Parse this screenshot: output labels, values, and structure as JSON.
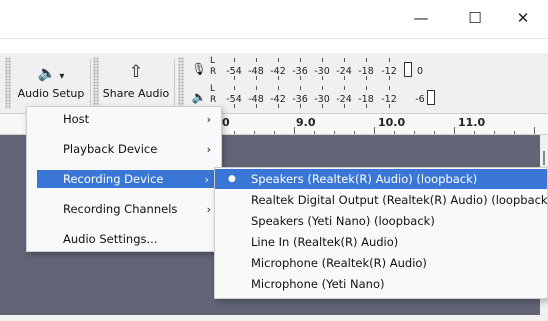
{
  "window": {
    "minimize_icon": "minimize-icon",
    "maximize_icon": "maximize-icon",
    "close_icon": "close-icon",
    "minimize_glyph": "—",
    "maximize_glyph": "☐",
    "close_glyph": "✕"
  },
  "toolbar": {
    "audio_setup": {
      "label": "Audio Setup",
      "icon": "speaker-icon",
      "glyph": "🔈",
      "dropdown_glyph": "▾"
    },
    "share_audio": {
      "label": "Share Audio",
      "icon": "share-icon",
      "glyph": "⇧"
    }
  },
  "meters": {
    "record": {
      "icon": "microphone-icon",
      "glyph": "🎙",
      "l": "L",
      "r": "R",
      "ticks": [
        "-54",
        "-48",
        "-42",
        "-36",
        "-30",
        "-24",
        "-18",
        "-12",
        "0"
      ]
    },
    "playback": {
      "icon": "speaker-icon",
      "glyph": "🔈",
      "l": "L",
      "r": "R",
      "ticks": [
        "-54",
        "-48",
        "-42",
        "-36",
        "-30",
        "-24",
        "-18",
        "-12",
        "-6"
      ]
    }
  },
  "ruler": {
    "labels": [
      "0",
      "9.0",
      "10.0",
      "11.0"
    ]
  },
  "audio_setup_menu": {
    "items": [
      {
        "label": "Host",
        "submenu": true
      },
      {
        "label": "Playback Device",
        "submenu": true
      },
      {
        "label": "Recording Device",
        "submenu": true,
        "selected": true
      },
      {
        "label": "Recording Channels",
        "submenu": true
      },
      {
        "label": "Audio Settings...",
        "submenu": false
      }
    ],
    "arrow_glyph": "›"
  },
  "recording_device_submenu": {
    "items": [
      {
        "label": "Speakers (Realtek(R) Audio) (loopback)",
        "checked": true
      },
      {
        "label": "Realtek Digital Output (Realtek(R) Audio) (loopback)",
        "checked": false
      },
      {
        "label": "Speakers (Yeti Nano) (loopback)",
        "checked": false
      },
      {
        "label": "Line In (Realtek(R) Audio)",
        "checked": false
      },
      {
        "label": "Microphone (Realtek(R) Audio)",
        "checked": false
      },
      {
        "label": "Microphone (Yeti Nano)",
        "checked": false
      }
    ],
    "check_glyph": "●"
  },
  "colors": {
    "accent": "#3a76d5",
    "track_bg": "#616576"
  }
}
